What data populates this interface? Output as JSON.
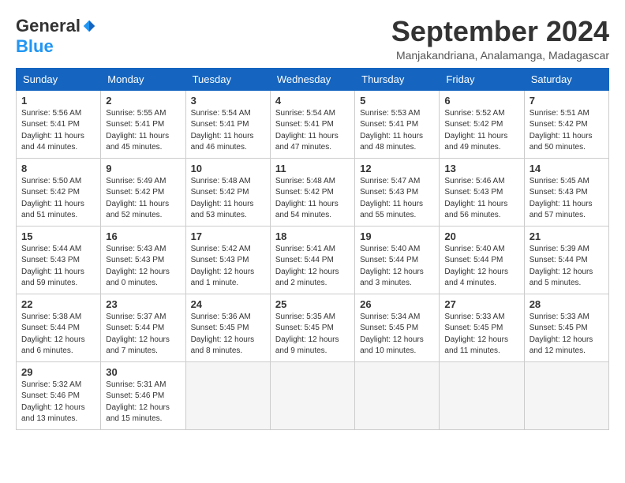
{
  "header": {
    "logo_general": "General",
    "logo_blue": "Blue",
    "month_title": "September 2024",
    "subtitle": "Manjakandriana, Analamanga, Madagascar"
  },
  "weekdays": [
    "Sunday",
    "Monday",
    "Tuesday",
    "Wednesday",
    "Thursday",
    "Friday",
    "Saturday"
  ],
  "weeks": [
    [
      {
        "day": "1",
        "info": "Sunrise: 5:56 AM\nSunset: 5:41 PM\nDaylight: 11 hours\nand 44 minutes."
      },
      {
        "day": "2",
        "info": "Sunrise: 5:55 AM\nSunset: 5:41 PM\nDaylight: 11 hours\nand 45 minutes."
      },
      {
        "day": "3",
        "info": "Sunrise: 5:54 AM\nSunset: 5:41 PM\nDaylight: 11 hours\nand 46 minutes."
      },
      {
        "day": "4",
        "info": "Sunrise: 5:54 AM\nSunset: 5:41 PM\nDaylight: 11 hours\nand 47 minutes."
      },
      {
        "day": "5",
        "info": "Sunrise: 5:53 AM\nSunset: 5:41 PM\nDaylight: 11 hours\nand 48 minutes."
      },
      {
        "day": "6",
        "info": "Sunrise: 5:52 AM\nSunset: 5:42 PM\nDaylight: 11 hours\nand 49 minutes."
      },
      {
        "day": "7",
        "info": "Sunrise: 5:51 AM\nSunset: 5:42 PM\nDaylight: 11 hours\nand 50 minutes."
      }
    ],
    [
      {
        "day": "8",
        "info": "Sunrise: 5:50 AM\nSunset: 5:42 PM\nDaylight: 11 hours\nand 51 minutes."
      },
      {
        "day": "9",
        "info": "Sunrise: 5:49 AM\nSunset: 5:42 PM\nDaylight: 11 hours\nand 52 minutes."
      },
      {
        "day": "10",
        "info": "Sunrise: 5:48 AM\nSunset: 5:42 PM\nDaylight: 11 hours\nand 53 minutes."
      },
      {
        "day": "11",
        "info": "Sunrise: 5:48 AM\nSunset: 5:42 PM\nDaylight: 11 hours\nand 54 minutes."
      },
      {
        "day": "12",
        "info": "Sunrise: 5:47 AM\nSunset: 5:43 PM\nDaylight: 11 hours\nand 55 minutes."
      },
      {
        "day": "13",
        "info": "Sunrise: 5:46 AM\nSunset: 5:43 PM\nDaylight: 11 hours\nand 56 minutes."
      },
      {
        "day": "14",
        "info": "Sunrise: 5:45 AM\nSunset: 5:43 PM\nDaylight: 11 hours\nand 57 minutes."
      }
    ],
    [
      {
        "day": "15",
        "info": "Sunrise: 5:44 AM\nSunset: 5:43 PM\nDaylight: 11 hours\nand 59 minutes."
      },
      {
        "day": "16",
        "info": "Sunrise: 5:43 AM\nSunset: 5:43 PM\nDaylight: 12 hours\nand 0 minutes."
      },
      {
        "day": "17",
        "info": "Sunrise: 5:42 AM\nSunset: 5:43 PM\nDaylight: 12 hours\nand 1 minute."
      },
      {
        "day": "18",
        "info": "Sunrise: 5:41 AM\nSunset: 5:44 PM\nDaylight: 12 hours\nand 2 minutes."
      },
      {
        "day": "19",
        "info": "Sunrise: 5:40 AM\nSunset: 5:44 PM\nDaylight: 12 hours\nand 3 minutes."
      },
      {
        "day": "20",
        "info": "Sunrise: 5:40 AM\nSunset: 5:44 PM\nDaylight: 12 hours\nand 4 minutes."
      },
      {
        "day": "21",
        "info": "Sunrise: 5:39 AM\nSunset: 5:44 PM\nDaylight: 12 hours\nand 5 minutes."
      }
    ],
    [
      {
        "day": "22",
        "info": "Sunrise: 5:38 AM\nSunset: 5:44 PM\nDaylight: 12 hours\nand 6 minutes."
      },
      {
        "day": "23",
        "info": "Sunrise: 5:37 AM\nSunset: 5:44 PM\nDaylight: 12 hours\nand 7 minutes."
      },
      {
        "day": "24",
        "info": "Sunrise: 5:36 AM\nSunset: 5:45 PM\nDaylight: 12 hours\nand 8 minutes."
      },
      {
        "day": "25",
        "info": "Sunrise: 5:35 AM\nSunset: 5:45 PM\nDaylight: 12 hours\nand 9 minutes."
      },
      {
        "day": "26",
        "info": "Sunrise: 5:34 AM\nSunset: 5:45 PM\nDaylight: 12 hours\nand 10 minutes."
      },
      {
        "day": "27",
        "info": "Sunrise: 5:33 AM\nSunset: 5:45 PM\nDaylight: 12 hours\nand 11 minutes."
      },
      {
        "day": "28",
        "info": "Sunrise: 5:33 AM\nSunset: 5:45 PM\nDaylight: 12 hours\nand 12 minutes."
      }
    ],
    [
      {
        "day": "29",
        "info": "Sunrise: 5:32 AM\nSunset: 5:46 PM\nDaylight: 12 hours\nand 13 minutes."
      },
      {
        "day": "30",
        "info": "Sunrise: 5:31 AM\nSunset: 5:46 PM\nDaylight: 12 hours\nand 15 minutes."
      },
      {
        "day": "",
        "info": ""
      },
      {
        "day": "",
        "info": ""
      },
      {
        "day": "",
        "info": ""
      },
      {
        "day": "",
        "info": ""
      },
      {
        "day": "",
        "info": ""
      }
    ]
  ]
}
